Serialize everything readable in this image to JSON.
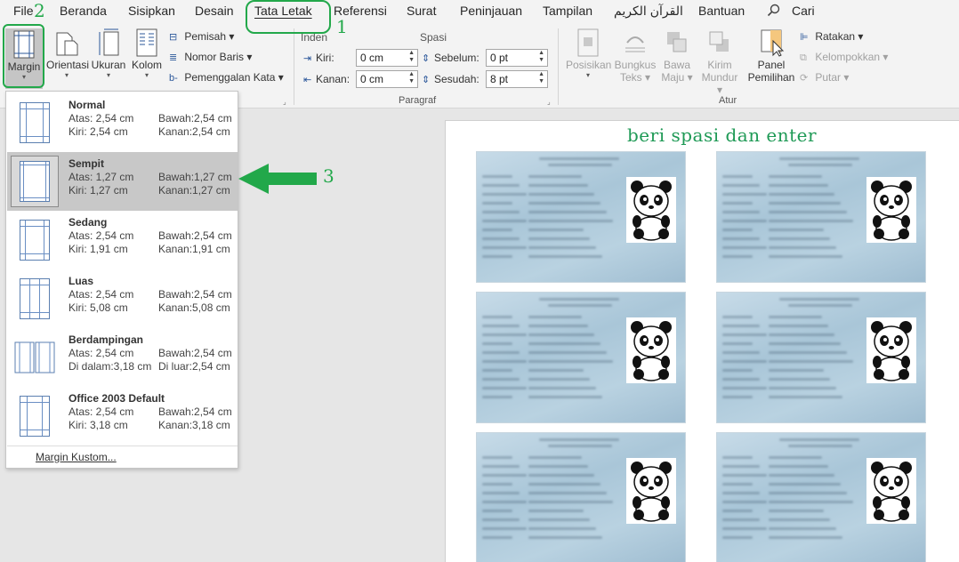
{
  "menu": {
    "items": [
      "File",
      "Beranda",
      "Sisipkan",
      "Desain",
      "Tata Letak",
      "Referensi",
      "Surat",
      "Peninjauan",
      "Tampilan",
      "القرآن الكريم",
      "Bantuan",
      "Cari"
    ],
    "active": "Tata Letak"
  },
  "ribbon": {
    "margin": "Margin",
    "orientasi": "Orientasi",
    "ukuran": "Ukuran",
    "kolom": "Kolom",
    "pemisah": "Pemisah",
    "nomor_baris": "Nomor Baris",
    "pemenggalan": "Pemenggalan Kata",
    "inden_label": "Inden",
    "spasi_label": "Spasi",
    "kiri_label": "Kiri:",
    "kiri_value": "0 cm",
    "kanan_label": "Kanan:",
    "kanan_value": "0 cm",
    "sebelum_label": "Sebelum:",
    "sebelum_value": "0 pt",
    "sesudah_label": "Sesudah:",
    "sesudah_value": "8 pt",
    "paragraf_group": "Paragraf",
    "posisikan": "Posisikan",
    "bungkus": "Bungkus",
    "teks": "Teks",
    "bawa": "Bawa",
    "maju": "Maju",
    "kirim": "Kirim",
    "mundur": "Mundur",
    "panel": "Panel",
    "pemilihan": "Pemilihan",
    "ratakan": "Ratakan",
    "kelompokkan": "Kelompokkan",
    "putar": "Putar",
    "atur_group": "Atur"
  },
  "margin_options": [
    {
      "name": "Normal",
      "atas": "Atas: 2,54 cm",
      "bawah": "Bawah:2,54 cm",
      "kiri": "Kiri:   2,54 cm",
      "kanan": "Kanan:2,54 cm"
    },
    {
      "name": "Sempit",
      "atas": "Atas: 1,27 cm",
      "bawah": "Bawah:1,27 cm",
      "kiri": "Kiri:   1,27 cm",
      "kanan": "Kanan:1,27 cm"
    },
    {
      "name": "Sedang",
      "atas": "Atas: 2,54 cm",
      "bawah": "Bawah:2,54 cm",
      "kiri": "Kiri:   1,91 cm",
      "kanan": "Kanan:1,91 cm"
    },
    {
      "name": "Luas",
      "atas": "Atas: 2,54 cm",
      "bawah": "Bawah:2,54 cm",
      "kiri": "Kiri:   5,08 cm",
      "kanan": "Kanan:5,08 cm"
    },
    {
      "name": "Berdampingan",
      "atas": "Atas: 2,54 cm",
      "bawah": "Bawah:2,54 cm",
      "kiri": "Di dalam:3,18 cm",
      "kanan": "Di luar:2,54 cm"
    },
    {
      "name": "Office 2003 Default",
      "atas": "Atas: 2,54 cm",
      "bawah": "Bawah:2,54 cm",
      "kiri": "Kiri:   3,18 cm",
      "kanan": "Kanan:3,18 cm"
    }
  ],
  "selected_option": "Sempit",
  "custom_margin": "Margin Kustom...",
  "annotations": {
    "step1": "1",
    "step2": "2",
    "step3": "3"
  },
  "document": {
    "title": "beri spasi dan enter"
  },
  "colors": {
    "annotation": "#22a84a",
    "title": "#1f9a56",
    "accent": "#2b579a"
  }
}
